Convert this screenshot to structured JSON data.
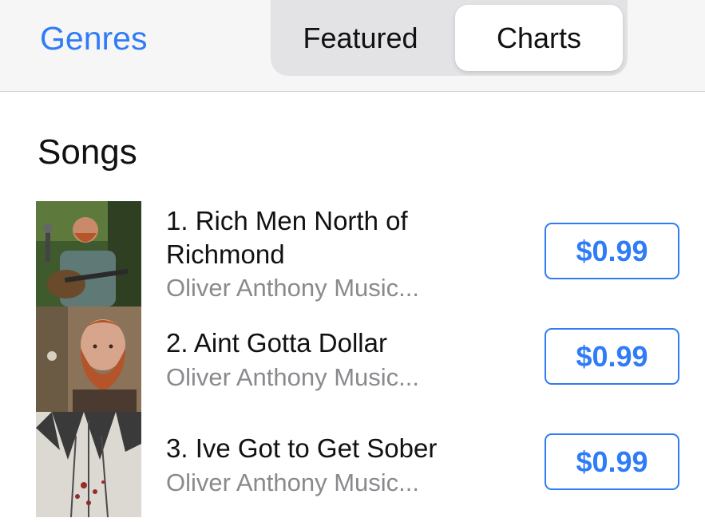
{
  "nav": {
    "back_label": "Genres",
    "segments": [
      "Featured",
      "Charts"
    ],
    "selected_segment": "Charts"
  },
  "section": {
    "title": "Songs"
  },
  "songs": [
    {
      "title": "1. Rich Men North of Richmond",
      "artist": "Oliver Anthony Music...",
      "price": "$0.99"
    },
    {
      "title": "2. Aint Gotta Dollar",
      "artist": "Oliver Anthony Music...",
      "price": "$0.99"
    },
    {
      "title": "3. Ive Got to Get Sober",
      "artist": "Oliver Anthony Music...",
      "price": "$0.99"
    }
  ],
  "colors": {
    "accent": "#2f7cf6",
    "secondary_text": "#8a8a8e",
    "nav_background": "#f6f6f7"
  }
}
